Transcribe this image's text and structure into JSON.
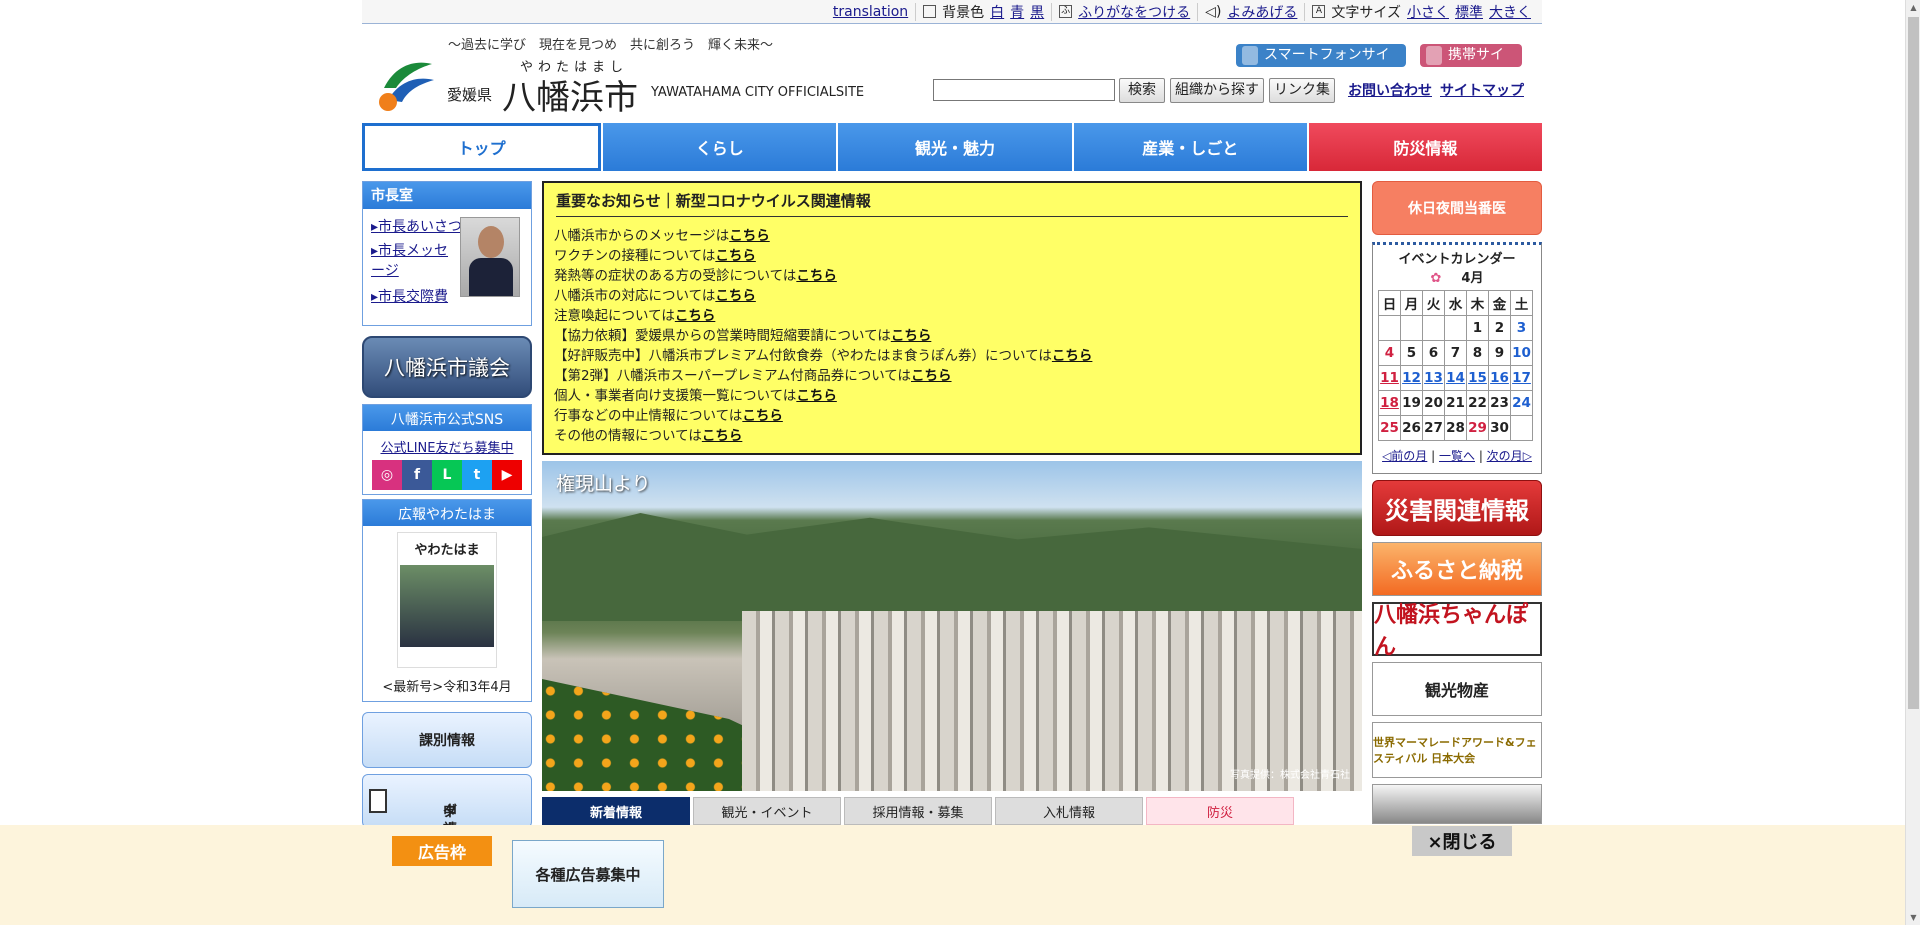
{
  "util": {
    "translation": "translation",
    "bg_label": "背景色",
    "bg_white": "白",
    "bg_blue": "青",
    "bg_black": "黒",
    "furigana": "ふりがなをつける",
    "yomiage": "よみあげる",
    "fontsize_label": "文字サイズ",
    "font_small": "小さく",
    "font_std": "標準",
    "font_large": "大きく"
  },
  "header": {
    "tagline": "～過去に学び　現在を見つめ　共に創ろう　輝く未来～",
    "pref": "愛媛県",
    "ruby": "やわたはまし",
    "city": "八幡浜市",
    "city_en": "YAWATAHAMA CITY OFFICIALSITE",
    "smartphone": "スマートフォンサイト",
    "mobile": "携帯サイト",
    "search_btn": "検索",
    "org_btn": "組織から探す",
    "links_btn": "リンク集",
    "contact": "お問い合わせ",
    "sitemap": "サイトマップ"
  },
  "nav": [
    "トップ",
    "くらし",
    "観光・魅力",
    "産業・しごと",
    "防災情報"
  ],
  "left": {
    "mayor_title": "市長室",
    "mayor_links": [
      "市長あいさつ",
      "市長メッセージ",
      "市長交際費"
    ],
    "gikai": "八幡浜市議会",
    "sns_title": "八幡浜市公式SNS",
    "line_text": "公式LINE友だち募集中",
    "sns_icons": [
      "◎",
      "f",
      "L",
      "t",
      "▶"
    ],
    "koho_title": "広報やわたはま",
    "koho_cover": "やわたはま",
    "koho_caption": "<最新号>令和3年4月",
    "kabetsu": "課別情報",
    "shinsei_1": "申請書",
    "shinsei_2": "ダウンロード"
  },
  "notice": {
    "title": "重要なお知らせ｜新型コロナウイルス関連情報",
    "link_text": "こちら",
    "items": [
      "八幡浜市からのメッセージは",
      "ワクチンの接種については",
      "発熱等の症状のある方の受診については",
      "八幡浜市の対応については",
      "注意喚起については",
      "【協力依頼】愛媛県からの営業時間短縮要請については",
      "【好評販売中】八幡浜市プレミアム付飲食券（やわたはま食うぽん券）については",
      "【第2弾】八幡浜市スーパープレミアム付商品券については",
      "個人・事業者向け支援策一覧については",
      "行事などの中止情報については",
      "その他の情報については"
    ]
  },
  "hero": {
    "caption": "権現山より",
    "credit": "写真提供：株式会社青石社"
  },
  "tabs": [
    "新着情報",
    "観光・イベント",
    "採用情報・募集",
    "入札情報",
    "防災"
  ],
  "right": {
    "kyujitsu": "休日夜間当番医",
    "cal_title": "イベントカレンダー",
    "cal_month": "4月",
    "weekdays": [
      "日",
      "月",
      "火",
      "水",
      "木",
      "金",
      "土"
    ],
    "weeks": [
      [
        "",
        "",
        "",
        "",
        "1",
        "2",
        "3"
      ],
      [
        "4",
        "5",
        "6",
        "7",
        "8",
        "9",
        "10"
      ],
      [
        "11",
        "12",
        "13",
        "14",
        "15",
        "16",
        "17"
      ],
      [
        "18",
        "19",
        "20",
        "21",
        "22",
        "23",
        "24"
      ],
      [
        "25",
        "26",
        "27",
        "28",
        "29",
        "30",
        ""
      ]
    ],
    "prev": "前の月",
    "list": "一覧へ",
    "next": "次の月",
    "banner_disaster": "災害関連情報",
    "banner_furusato": "ふるさと納税",
    "banner_champon": "八幡浜ちゃんぽん",
    "banner_kanko": "観光物産",
    "banner_marmalade": "世界マーマレードアワード&フェスティバル 日本大会"
  },
  "ad": {
    "tag": "広告枠",
    "btn": "各種広告募集中",
    "close": "×閉じる"
  }
}
